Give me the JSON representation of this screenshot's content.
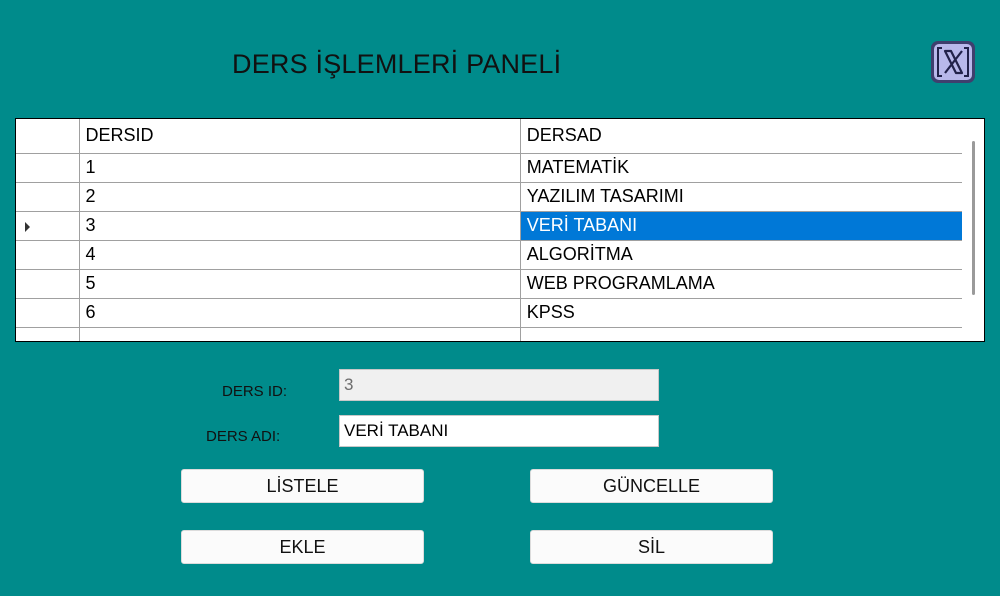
{
  "window": {
    "title": "DERS İŞLEMLERİ PANELİ",
    "close_icon": "close-x-icon",
    "accent": "#008b8b"
  },
  "grid": {
    "columns": [
      "DERSID",
      "DERSAD"
    ],
    "rows": [
      {
        "id": "1",
        "name": "MATEMATİK"
      },
      {
        "id": "2",
        "name": "YAZILIM TASARIMI"
      },
      {
        "id": "3",
        "name": "VERİ TABANI"
      },
      {
        "id": "4",
        "name": "ALGORİTMA"
      },
      {
        "id": "5",
        "name": "WEB PROGRAMLAMA"
      },
      {
        "id": "6",
        "name": "KPSS"
      }
    ],
    "selected_row": "3",
    "selection_color": "#0078d7"
  },
  "form": {
    "id_label": "DERS ID:",
    "id_value": "3",
    "name_label": "DERS ADI:",
    "name_value": "VERİ TABANI"
  },
  "buttons": {
    "list": "LİSTELE",
    "update": "GÜNCELLE",
    "add": "EKLE",
    "delete": "SİL"
  }
}
